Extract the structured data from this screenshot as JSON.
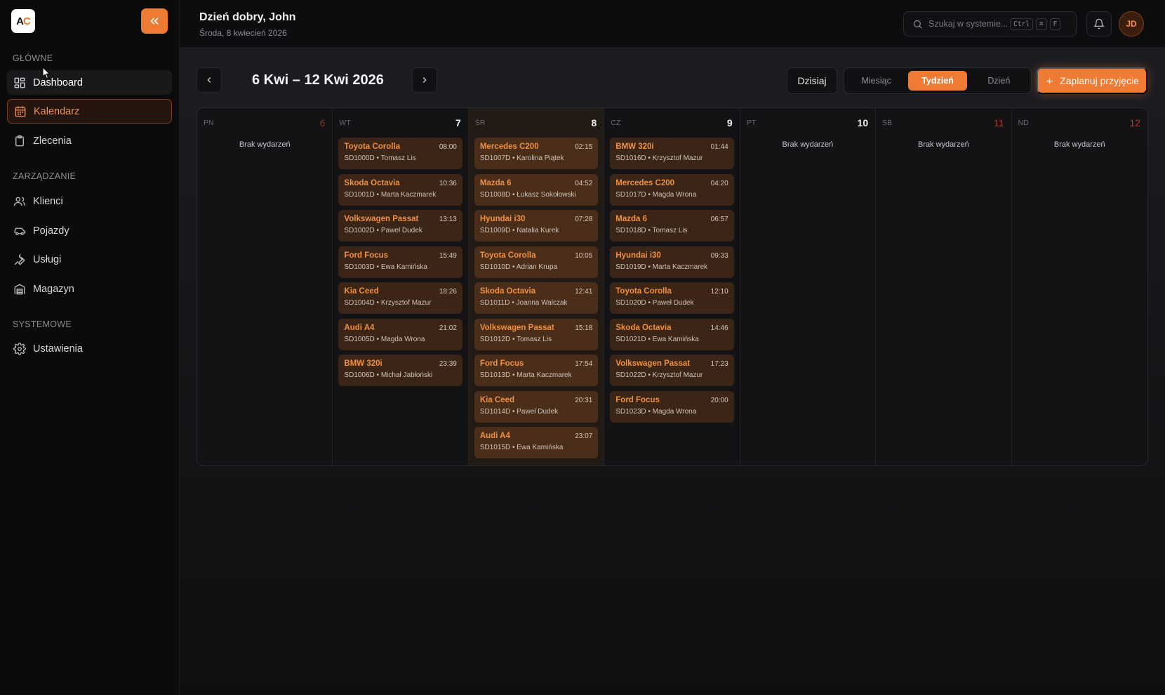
{
  "brand": {
    "logo_text_a": "A",
    "logo_text_c": "C"
  },
  "sidebar": {
    "sections": [
      {
        "title": "GŁÓWNE"
      },
      {
        "title": "ZARZĄDZANIE"
      },
      {
        "title": "SYSTEMOWE"
      }
    ],
    "items": [
      {
        "label": "Dashboard",
        "icon": "dashboard-icon",
        "state": "hover"
      },
      {
        "label": "Kalendarz",
        "icon": "calendar-icon",
        "state": "active"
      },
      {
        "label": "Zlecenia",
        "icon": "clipboard-icon"
      },
      {
        "label": "Klienci",
        "icon": "users-icon"
      },
      {
        "label": "Pojazdy",
        "icon": "car-icon"
      },
      {
        "label": "Usługi",
        "icon": "wrench-icon"
      },
      {
        "label": "Magazyn",
        "icon": "warehouse-icon"
      },
      {
        "label": "Ustawienia",
        "icon": "gear-icon"
      }
    ]
  },
  "header": {
    "greeting": "Dzień dobry, John",
    "date": "Środa, 8 kwiecień 2026",
    "search_placeholder": "Szukaj w systemie...",
    "kbd": [
      "Ctrl",
      "⌘",
      "F"
    ],
    "avatar_initials": "JD"
  },
  "toolbar": {
    "range": "6 Kwi – 12 Kwi 2026",
    "today_label": "Dzisiaj",
    "views": [
      "Miesiąc",
      "Tydzień",
      "Dzień"
    ],
    "selected_view": "Tydzień",
    "plan_label": "Zaplanuj przyjęcie"
  },
  "colors": {
    "accent": "#ee7b33",
    "event_bg": "#3a2516",
    "today_bg": "#221a15"
  },
  "calendar": {
    "empty_label": "Brak wydarzeń",
    "days": [
      {
        "dow": "PN",
        "num": "6",
        "style": "red",
        "events": []
      },
      {
        "dow": "WT",
        "num": "7",
        "events": [
          {
            "car": "Toyota Corolla",
            "time": "08:00",
            "sub": "SD1000D • Tomasz Lis"
          },
          {
            "car": "Skoda Octavia",
            "time": "10:36",
            "sub": "SD1001D • Marta Kaczmarek"
          },
          {
            "car": "Volkswagen Passat",
            "time": "13:13",
            "sub": "SD1002D • Paweł Dudek"
          },
          {
            "car": "Ford Focus",
            "time": "15:49",
            "sub": "SD1003D • Ewa Kamińska"
          },
          {
            "car": "Kia Ceed",
            "time": "18:26",
            "sub": "SD1004D • Krzysztof Mazur"
          },
          {
            "car": "Audi A4",
            "time": "21:02",
            "sub": "SD1005D • Magda Wrona"
          },
          {
            "car": "BMW 320i",
            "time": "23:39",
            "sub": "SD1006D • Michał Jabłoński"
          }
        ]
      },
      {
        "dow": "ŚR",
        "num": "8",
        "today": true,
        "events": [
          {
            "car": "Mercedes C200",
            "time": "02:15",
            "sub": "SD1007D • Karolina Piątek"
          },
          {
            "car": "Mazda 6",
            "time": "04:52",
            "sub": "SD1008D • Łukasz Sokołowski"
          },
          {
            "car": "Hyundai i30",
            "time": "07:28",
            "sub": "SD1009D • Natalia Kurek"
          },
          {
            "car": "Toyota Corolla",
            "time": "10:05",
            "sub": "SD1010D • Adrian Krupa"
          },
          {
            "car": "Skoda Octavia",
            "time": "12:41",
            "sub": "SD1011D • Joanna Walczak"
          },
          {
            "car": "Volkswagen Passat",
            "time": "15:18",
            "sub": "SD1012D • Tomasz Lis"
          },
          {
            "car": "Ford Focus",
            "time": "17:54",
            "sub": "SD1013D • Marta Kaczmarek"
          },
          {
            "car": "Kia Ceed",
            "time": "20:31",
            "sub": "SD1014D • Paweł Dudek"
          },
          {
            "car": "Audi A4",
            "time": "23:07",
            "sub": "SD1015D • Ewa Kamińska"
          }
        ]
      },
      {
        "dow": "CZ",
        "num": "9",
        "events": [
          {
            "car": "BMW 320i",
            "time": "01:44",
            "sub": "SD1016D • Krzysztof Mazur"
          },
          {
            "car": "Mercedes C200",
            "time": "04:20",
            "sub": "SD1017D • Magda Wrona"
          },
          {
            "car": "Mazda 6",
            "time": "06:57",
            "sub": "SD1018D • Tomasz Lis"
          },
          {
            "car": "Hyundai i30",
            "time": "09:33",
            "sub": "SD1019D • Marta Kaczmarek"
          },
          {
            "car": "Toyota Corolla",
            "time": "12:10",
            "sub": "SD1020D • Paweł Dudek"
          },
          {
            "car": "Skoda Octavia",
            "time": "14:46",
            "sub": "SD1021D • Ewa Kamińska"
          },
          {
            "car": "Volkswagen Passat",
            "time": "17:23",
            "sub": "SD1022D • Krzysztof Mazur"
          },
          {
            "car": "Ford Focus",
            "time": "20:00",
            "sub": "SD1023D • Magda Wrona"
          }
        ]
      },
      {
        "dow": "PT",
        "num": "10",
        "events": []
      },
      {
        "dow": "SB",
        "num": "11",
        "style": "weekend",
        "events": []
      },
      {
        "dow": "ND",
        "num": "12",
        "style": "weekend",
        "events": []
      }
    ]
  }
}
